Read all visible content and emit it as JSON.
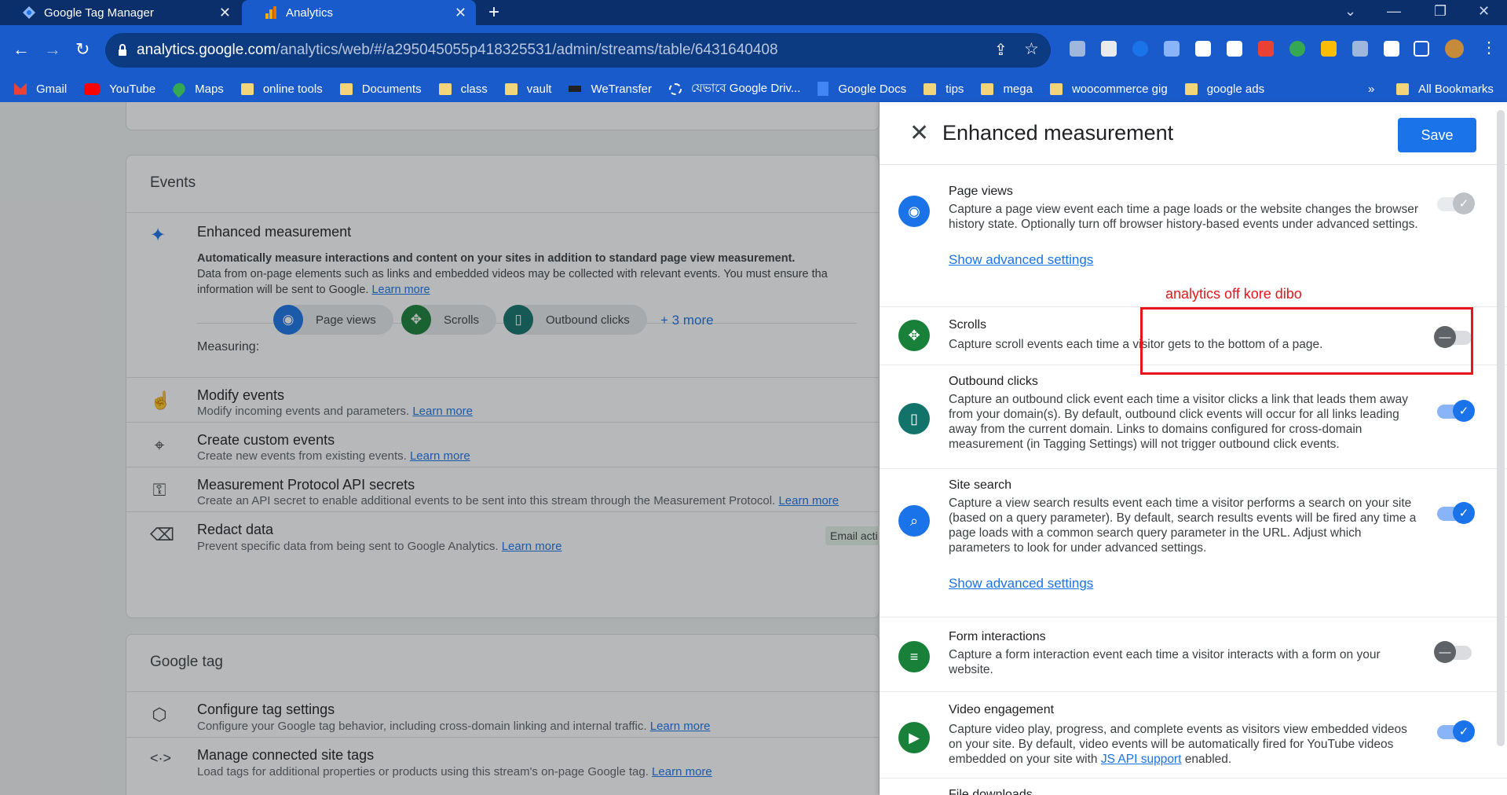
{
  "browser": {
    "tabs": [
      {
        "label": "Google Tag Manager"
      },
      {
        "label": "Analytics"
      }
    ],
    "url_host": "analytics.google.com",
    "url_path": "/analytics/web/#/a295045055p418325531/admin/streams/table/6431640408",
    "bookmarks": [
      "Gmail",
      "YouTube",
      "Maps",
      "online tools",
      "Documents",
      "class",
      "vault",
      "WeTransfer",
      "যেভাবে Google Driv...",
      "Google Docs",
      "tips",
      "mega",
      "woocommerce gig",
      "google ads"
    ],
    "more_bookmarks": "»",
    "all_bookmarks": "All Bookmarks"
  },
  "events_card": {
    "heading": "Events",
    "enhanced_title": "Enhanced measurement",
    "enhanced_bold": "Automatically measure interactions and content on your sites in addition to standard page view measurement.",
    "enhanced_line2": "Data from on-page elements such as links and embedded videos may be collected with relevant events. You must ensure tha",
    "enhanced_line3": "information will be sent to Google.",
    "learn_more": "Learn more",
    "measuring_label": "Measuring:",
    "chips": [
      "Page views",
      "Scrolls",
      "Outbound clicks"
    ],
    "more": "+ 3 more",
    "rows": [
      {
        "title": "Modify events",
        "desc": "Modify incoming events and parameters."
      },
      {
        "title": "Create custom events",
        "desc": "Create new events from existing events."
      },
      {
        "title": "Measurement Protocol API secrets",
        "desc": "Create an API secret to enable additional events to be sent into this stream through the Measurement Protocol."
      },
      {
        "title": "Redact data",
        "desc": "Prevent specific data from being sent to Google Analytics.",
        "badge": "Email acti"
      }
    ]
  },
  "tag_card": {
    "heading": "Google tag",
    "rows": [
      {
        "title": "Configure tag settings",
        "desc": "Configure your Google tag behavior, including cross-domain linking and internal traffic."
      },
      {
        "title": "Manage connected site tags",
        "desc": "Load tags for additional properties or products using this stream's on-page Google tag."
      }
    ]
  },
  "panel": {
    "title": "Enhanced measurement",
    "save": "Save",
    "show_advanced": "Show advanced settings",
    "settings": [
      {
        "title": "Page views",
        "desc": "Capture a page view event each time a page loads or the website changes the browser history state. Optionally turn off browser history-based events under advanced settings.",
        "state": "on-disabled"
      },
      {
        "title": "Scrolls",
        "desc": "Capture scroll events each time a visitor gets to the bottom of a page.",
        "state": "off"
      },
      {
        "title": "Outbound clicks",
        "desc": "Capture an outbound click event each time a visitor clicks a link that leads them away from your domain(s). By default, outbound click events will occur for all links leading away from the current domain. Links to domains configured for cross-domain measurement (in Tagging Settings) will not trigger outbound click events.",
        "state": "on"
      },
      {
        "title": "Site search",
        "desc": "Capture a view search results event each time a visitor performs a search on your site (based on a query parameter). By default, search results events will be fired any time a page loads with a common search query parameter in the URL. Adjust which parameters to look for under advanced settings.",
        "state": "on"
      },
      {
        "title": "Form interactions",
        "desc": "Capture a form interaction event each time a visitor interacts with a form on your website.",
        "state": "off"
      },
      {
        "title": "Video engagement",
        "desc_pre": "Capture video play, progress, and complete events as visitors view embedded videos on your site. By default, video events will be automatically fired for YouTube videos embedded on your site with ",
        "desc_link": "JS API support",
        "desc_post": " enabled.",
        "state": "on"
      },
      {
        "title": "File downloads"
      }
    ]
  },
  "annotation": "analytics off kore dibo",
  "colors": {
    "accent": "#1a73e8",
    "annotation": "#e8161b",
    "green": "#188038",
    "teal": "#12736a"
  }
}
